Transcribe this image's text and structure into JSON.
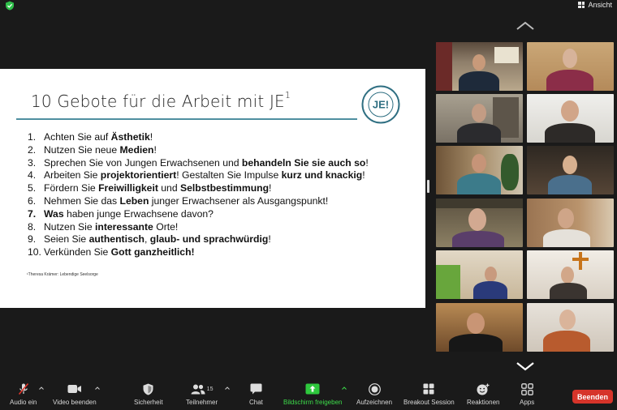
{
  "top_bar": {
    "view_label": "Ansicht"
  },
  "slide": {
    "title": "10 Gebote für die Arbeit mit JE",
    "title_sup": "1",
    "logo_text": "JE!",
    "logo_ring_top": "BISTUM REGENSBURG",
    "logo_ring_bottom": "JUNGE ERWACHSENE",
    "items": [
      {
        "num": "1.",
        "parts": [
          [
            "Achten Sie auf ",
            false
          ],
          [
            "Ästhetik",
            true
          ],
          [
            "!",
            false
          ]
        ]
      },
      {
        "num": "2.",
        "parts": [
          [
            "Nutzen Sie neue ",
            false
          ],
          [
            "Medien",
            true
          ],
          [
            "!",
            false
          ]
        ]
      },
      {
        "num": "3.",
        "parts": [
          [
            "Sprechen Sie von Jungen Erwachsenen und ",
            false
          ],
          [
            "behandeln Sie sie auch so",
            true
          ],
          [
            "!",
            false
          ]
        ]
      },
      {
        "num": "4.",
        "parts": [
          [
            "Arbeiten Sie ",
            false
          ],
          [
            "projektorientiert",
            true
          ],
          [
            "! Gestalten Sie Impulse ",
            false
          ],
          [
            "kurz und knackig",
            true
          ],
          [
            "!",
            false
          ]
        ]
      },
      {
        "num": "5.",
        "parts": [
          [
            "Fördern Sie ",
            false
          ],
          [
            "Freiwilligkeit",
            true
          ],
          [
            " und ",
            false
          ],
          [
            "Selbstbestimmung",
            true
          ],
          [
            "!",
            false
          ]
        ]
      },
      {
        "num": "6.",
        "parts": [
          [
            "Nehmen Sie das ",
            false
          ],
          [
            "Leben",
            true
          ],
          [
            " junger Erwachsener als Ausgangspunkt!",
            false
          ]
        ]
      },
      {
        "num": "7.",
        "parts": [
          [
            "Was",
            true
          ],
          [
            " haben junge Erwachsene davon?",
            false
          ]
        ]
      },
      {
        "num": "8.",
        "parts": [
          [
            "Nutzen Sie ",
            false
          ],
          [
            "interessante",
            true
          ],
          [
            " Orte!",
            false
          ]
        ]
      },
      {
        "num": "9.",
        "parts": [
          [
            "Seien Sie ",
            false
          ],
          [
            "authentisch",
            true
          ],
          [
            ", ",
            false
          ],
          [
            "glaub- und sprachwürdig",
            true
          ],
          [
            "!",
            false
          ]
        ]
      },
      {
        "num": "10.",
        "parts": [
          [
            "Verkünden Sie ",
            false
          ],
          [
            "Gott ganzheitlich!",
            true
          ]
        ]
      }
    ],
    "footnote": "¹Theresa Krämer: Lebendige Seelsorge"
  },
  "participants_count": "15",
  "toolbar": {
    "audio": "Audio ein",
    "video": "Video beenden",
    "security": "Sicherheit",
    "participants": "Teilnehmer",
    "chat": "Chat",
    "share": "Bildschirm freigeben",
    "record": "Aufzeichnen",
    "breakout": "Breakout Session",
    "reactions": "Reaktionen",
    "apps": "Apps",
    "end": "Beenden"
  },
  "colors": {
    "share_green": "#3ddc4a",
    "end_red": "#d6342a",
    "active_speaker": "#3fcf3f",
    "title_rule": "#4f8fa0"
  }
}
